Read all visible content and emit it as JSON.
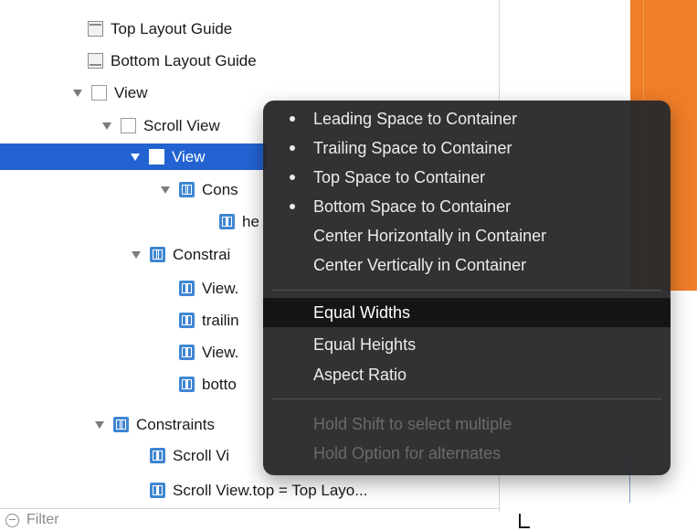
{
  "outline": {
    "rows": [
      {
        "label": "Top Layout Guide"
      },
      {
        "label": "Bottom Layout Guide"
      },
      {
        "label": "View"
      },
      {
        "label": "Scroll View"
      },
      {
        "label": "View"
      },
      {
        "label": "Cons"
      },
      {
        "label": "he"
      },
      {
        "label": "Constrai"
      },
      {
        "label": "View."
      },
      {
        "label": "trailin"
      },
      {
        "label": "View."
      },
      {
        "label": "botto"
      },
      {
        "label": "Constraints"
      },
      {
        "label": "Scroll Vi"
      },
      {
        "label": "Scroll View.top = Top Layo..."
      }
    ],
    "filter_placeholder": "Filter"
  },
  "menu": {
    "items": [
      {
        "label": "Leading Space to Container",
        "checked": true
      },
      {
        "label": "Trailing Space to Container",
        "checked": true
      },
      {
        "label": "Top Space to Container",
        "checked": true
      },
      {
        "label": "Bottom Space to Container",
        "checked": true
      },
      {
        "label": "Center Horizontally in Container",
        "checked": false
      },
      {
        "label": "Center Vertically in Container",
        "checked": false
      },
      {
        "label": "Equal Widths",
        "highlighted": true
      },
      {
        "label": "Equal Heights"
      },
      {
        "label": "Aspect Ratio"
      },
      {
        "label": "Hold Shift to select multiple",
        "disabled": true
      },
      {
        "label": "Hold Option for alternates",
        "disabled": true
      }
    ]
  },
  "colors": {
    "selection": "#2363d1",
    "canvas_view": "#f07d28",
    "menu_background": "#2a2a2c",
    "constraint_icon": "#3f86d2"
  }
}
